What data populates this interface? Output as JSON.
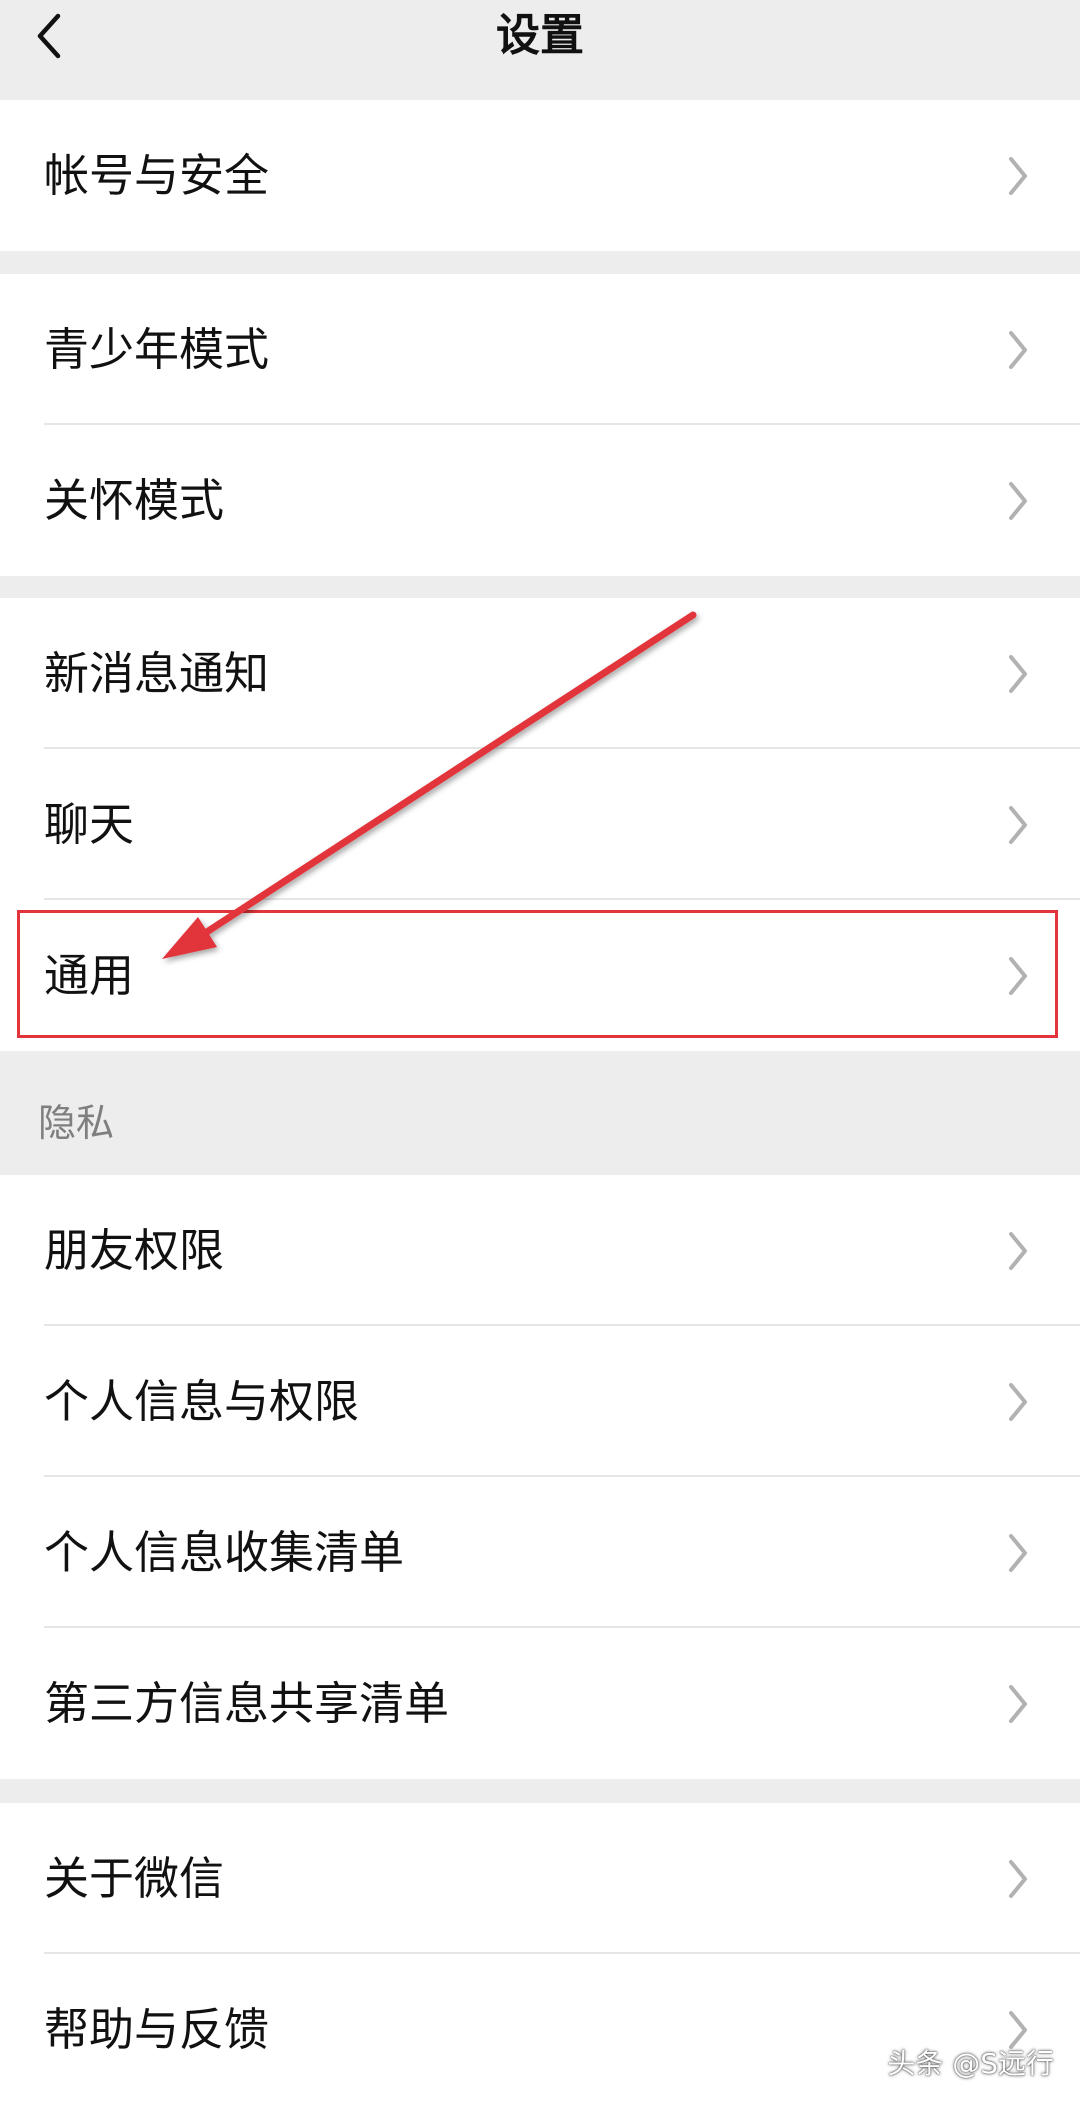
{
  "header": {
    "title": "设置",
    "back_icon": "chevron-left-icon"
  },
  "groups": [
    {
      "items": [
        "帐号与安全"
      ]
    },
    {
      "items": [
        "青少年模式",
        "关怀模式"
      ]
    },
    {
      "items": [
        "新消息通知",
        "聊天",
        "通用"
      ]
    },
    {
      "section_title": "隐私",
      "items": [
        "朋友权限",
        "个人信息与权限",
        "个人信息收集清单",
        "第三方信息共享清单"
      ]
    },
    {
      "items": [
        "关于微信",
        "帮助与反馈"
      ]
    }
  ],
  "annotation": {
    "highlighted_item": "通用",
    "color": "#e2343a"
  },
  "watermark": "头条 @S远行",
  "colors": {
    "background": "#ededed",
    "card": "#ffffff",
    "text": "#111111",
    "section_text": "#7f7f7f",
    "chevron": "#b2b2b2"
  }
}
